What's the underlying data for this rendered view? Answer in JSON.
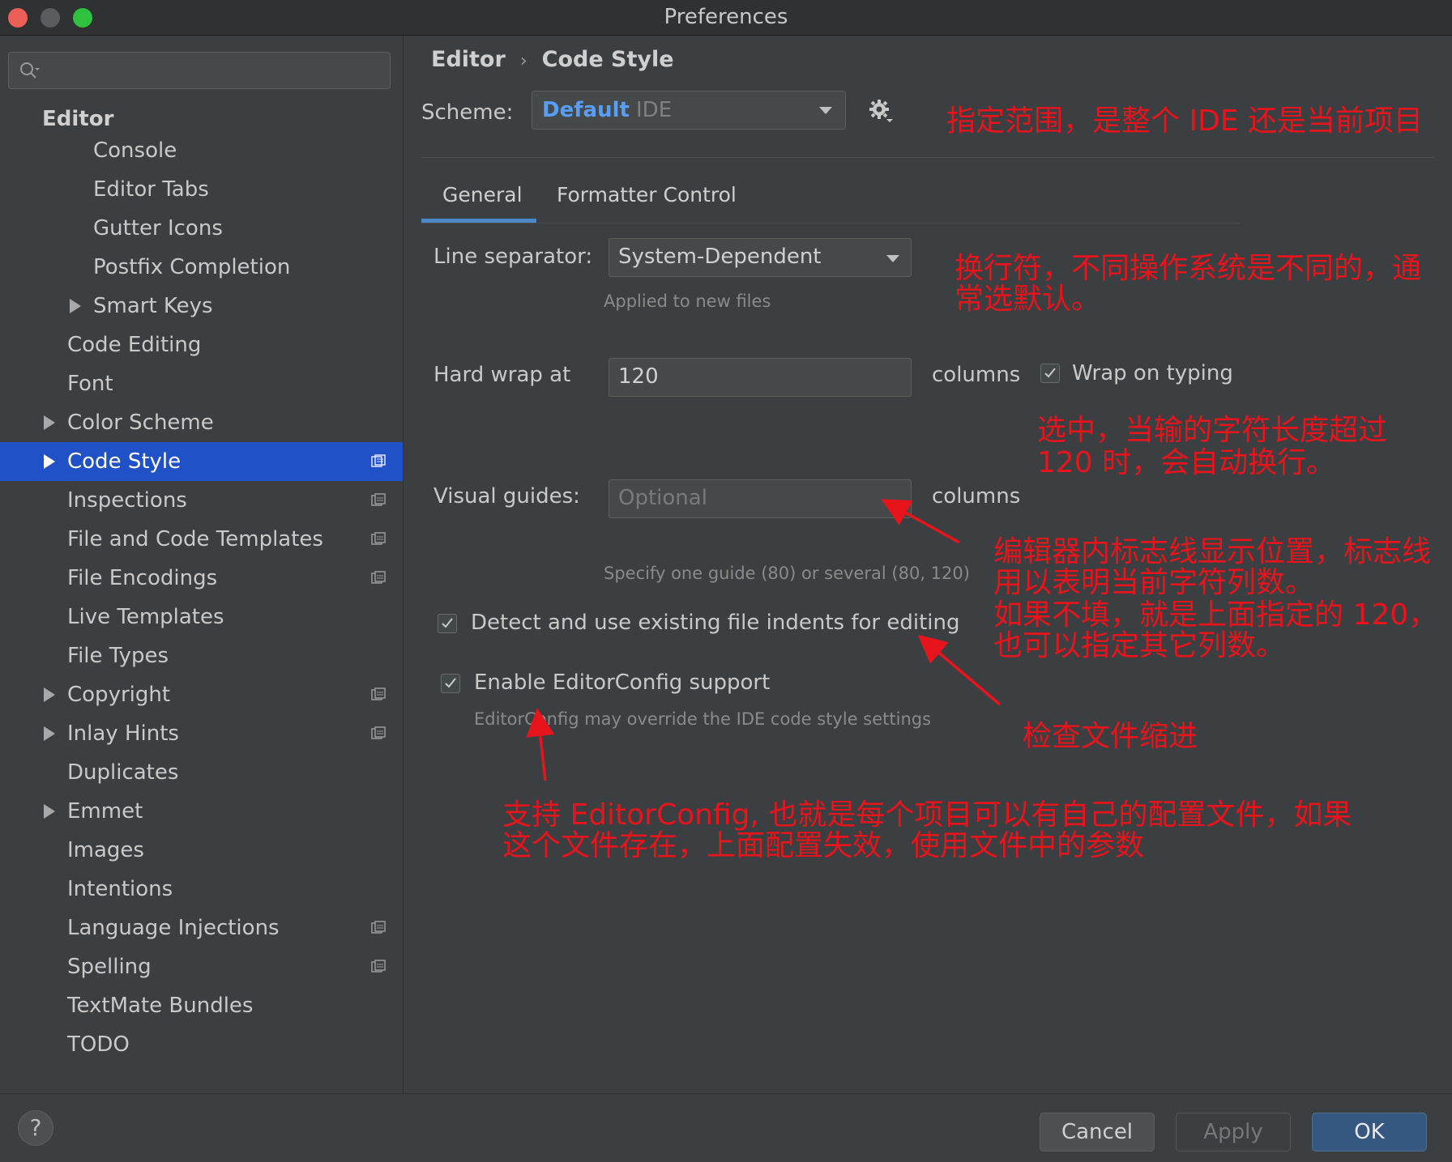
{
  "window": {
    "title": "Preferences"
  },
  "sidebar": {
    "search_placeholder": "",
    "section": "Editor",
    "items": [
      {
        "label": "Console"
      },
      {
        "label": "Editor Tabs"
      },
      {
        "label": "Gutter Icons"
      },
      {
        "label": "Postfix Completion"
      },
      {
        "label": "Smart Keys"
      },
      {
        "label": "Code Editing"
      },
      {
        "label": "Font"
      },
      {
        "label": "Color Scheme"
      },
      {
        "label": "Code Style"
      },
      {
        "label": "Inspections"
      },
      {
        "label": "File and Code Templates"
      },
      {
        "label": "File Encodings"
      },
      {
        "label": "Live Templates"
      },
      {
        "label": "File Types"
      },
      {
        "label": "Copyright"
      },
      {
        "label": "Inlay Hints"
      },
      {
        "label": "Duplicates"
      },
      {
        "label": "Emmet"
      },
      {
        "label": "Images"
      },
      {
        "label": "Intentions"
      },
      {
        "label": "Language Injections"
      },
      {
        "label": "Spelling"
      },
      {
        "label": "TextMate Bundles"
      },
      {
        "label": "TODO"
      }
    ],
    "selected": "Code Style"
  },
  "main": {
    "breadcrumb": {
      "root": "Editor",
      "separator": "›",
      "current": "Code Style"
    },
    "scheme": {
      "label": "Scheme:",
      "name": "Default",
      "scope": "IDE"
    },
    "tabs": [
      {
        "label": "General",
        "active": true
      },
      {
        "label": "Formatter Control",
        "active": false
      }
    ],
    "line_separator": {
      "label": "Line separator:",
      "value": "System-Dependent",
      "hint": "Applied to new files"
    },
    "hard_wrap": {
      "label": "Hard wrap at",
      "value": "120",
      "unit": "columns",
      "wrap_on_typing_label": "Wrap on typing",
      "wrap_on_typing_checked": true
    },
    "visual_guides": {
      "label": "Visual guides:",
      "placeholder": "Optional",
      "unit": "columns",
      "hint": "Specify one guide (80) or several (80, 120)"
    },
    "detect_indents": {
      "label": "Detect and use existing file indents for editing",
      "checked": true
    },
    "editorconfig": {
      "label": "Enable EditorConfig support",
      "checked": true,
      "hint": "EditorConfig may override the IDE code style settings"
    }
  },
  "annotations": {
    "scheme": "指定范围，是整个 IDE 还是当前项目",
    "line_sep_1": "换行符，不同操作系统是不同的，通",
    "line_sep_2": "常选默认。",
    "wrap_1": "选中，当输的字符长度超过",
    "wrap_2": "120 时，会自动换行。",
    "guides_1": "编辑器内标志线显示位置，标志线",
    "guides_2": "用以表明当前字符列数。",
    "guides_3": "如果不填，就是上面指定的 120，",
    "guides_4": "也可以指定其它列数。",
    "indents": "检查文件缩进",
    "editorconfig_1": "支持 EditorConfig, 也就是每个项目可以有自己的配置文件，如果",
    "editorconfig_2": "这个文件存在，上面配置失效，使用文件中的参数"
  },
  "footer": {
    "help": "?",
    "cancel": "Cancel",
    "apply": "Apply",
    "ok": "OK"
  },
  "colors": {
    "selection": "#2151c6",
    "accent_link": "#589df6",
    "annotation": "#e8141c",
    "ok_button": "#365880"
  }
}
